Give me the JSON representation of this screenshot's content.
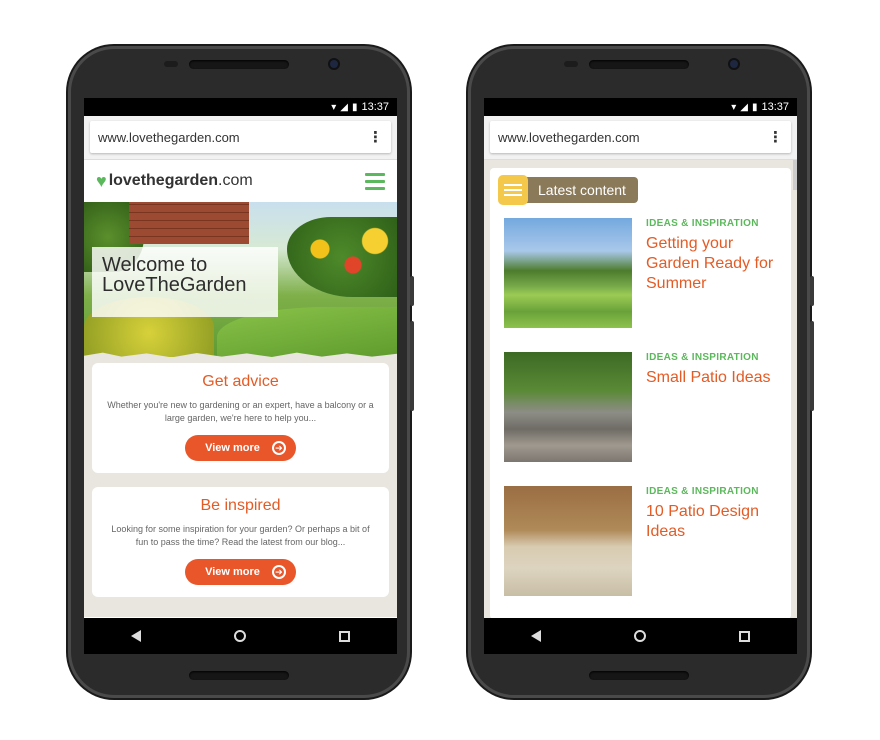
{
  "phones": [
    {
      "status": {
        "time": "13:37"
      },
      "browser": {
        "url": "www.lovethegarden.com",
        "menu_icon": "overflow-menu-icon"
      },
      "site": {
        "logo_part1": "love",
        "logo_part2": "thegarden",
        "logo_part3": ".com",
        "hero": {
          "welcome_line1": "Welcome to",
          "welcome_line2": "LoveTheGarden"
        },
        "cards": [
          {
            "title": "Get advice",
            "text": "Whether you're new to gardening or an expert, have a balcony or a large garden, we're here to help you...",
            "button": "View more"
          },
          {
            "title": "Be inspired",
            "text": "Looking for some inspiration for your garden? Or perhaps a bit of fun to pass the time? Read the latest from our blog...",
            "button": "View more"
          }
        ]
      }
    },
    {
      "status": {
        "time": "13:37"
      },
      "browser": {
        "url": "www.lovethegarden.com",
        "menu_icon": "overflow-menu-icon"
      },
      "site": {
        "section_label": "Latest content",
        "articles": [
          {
            "category": "IDEAS & INSPIRATION",
            "title": "Getting your Garden Ready for Summer"
          },
          {
            "category": "IDEAS & INSPIRATION",
            "title": "Small Patio Ideas"
          },
          {
            "category": "IDEAS & INSPIRATION",
            "title": "10 Patio Design Ideas"
          }
        ]
      }
    }
  ],
  "colors": {
    "brand_green": "#5cb85c",
    "accent_orange": "#e35b25",
    "button_orange": "#e8562a",
    "banner_brown": "#8a7a5a"
  }
}
